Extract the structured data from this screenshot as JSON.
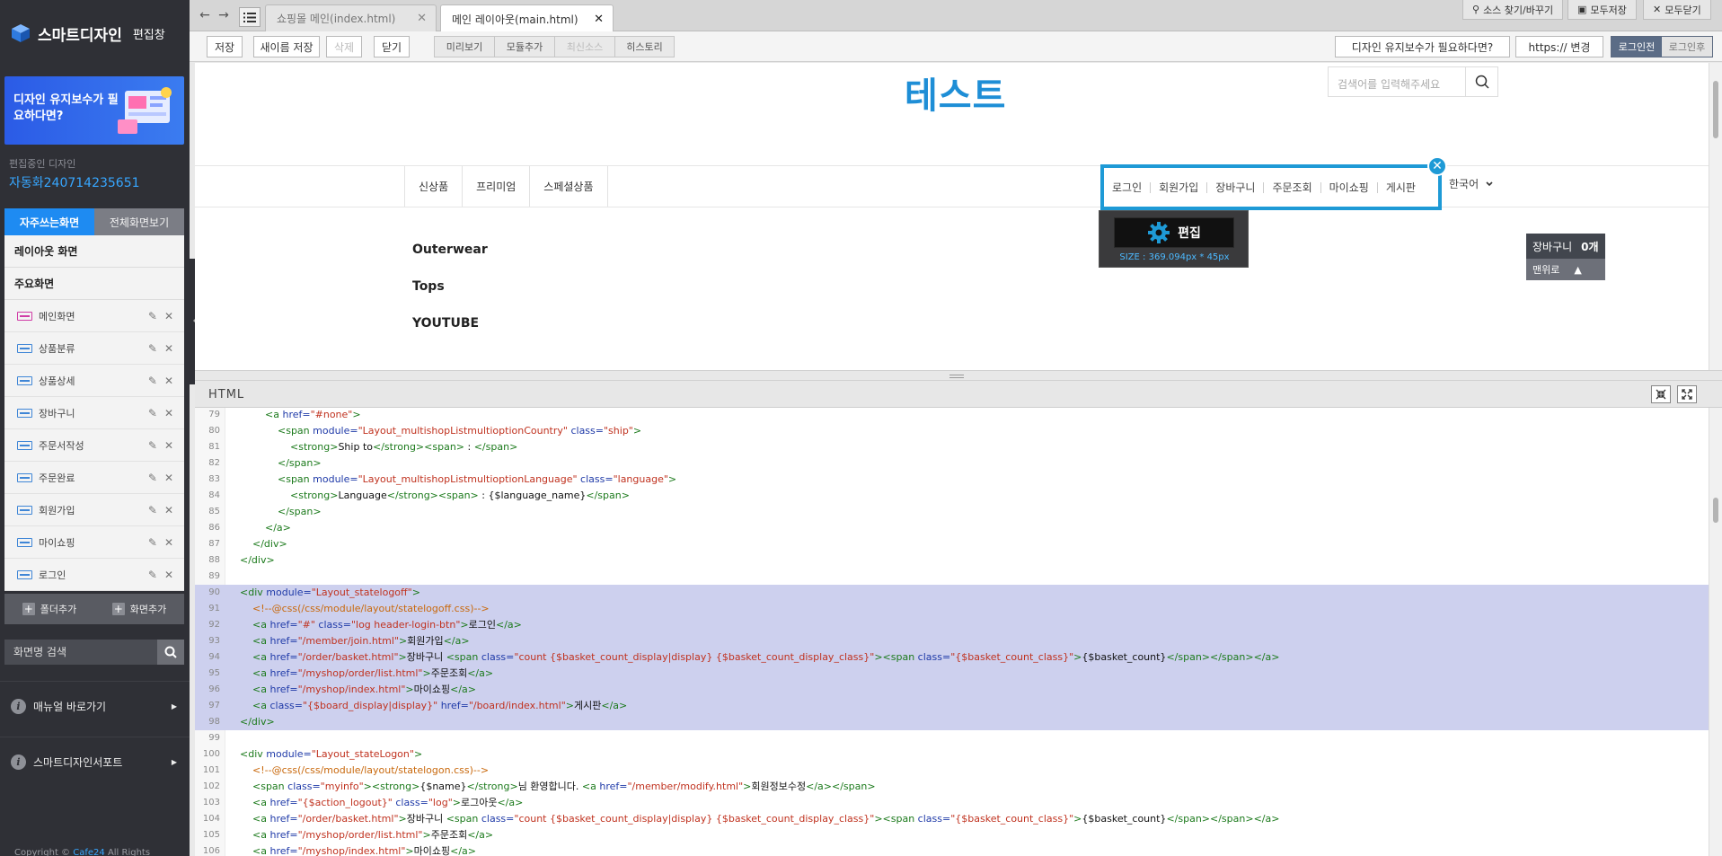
{
  "sidebar": {
    "brand": "스마트디자인",
    "brand_sub": "편집창",
    "banner_text": "디자인 유지보수가 필요하다면?",
    "editing_label": "편집중인 디자인",
    "editing_name": "자동화240714235651",
    "tab_frequent": "자주쓰는화면",
    "tab_all": "전체화면보기",
    "sections": [
      "레이아웃 화면",
      "주요화면"
    ],
    "pages": [
      "메인화면",
      "상품분류",
      "상품상세",
      "장바구니",
      "주문서작성",
      "주문완료",
      "회원가입",
      "마이쇼핑",
      "로그인"
    ],
    "add_folder": "폴더추가",
    "add_screen": "화면추가",
    "search_placeholder": "화면명 검색",
    "manual_link": "매뉴얼 바로가기",
    "support_link": "스마트디자인서포트",
    "copyright_prefix": "Copyright ©",
    "copyright_brand": "Cafe24",
    "copyright_suffix": "All Rights"
  },
  "topbar": {
    "tabs": [
      {
        "label": "쇼핑몰 메인(index.html)",
        "active": false
      },
      {
        "label": "메인 레이아웃(main.html)",
        "active": true
      }
    ],
    "find_replace": "소스 찾기/바꾸기",
    "save_all": "모두저장",
    "close_all": "모두닫기"
  },
  "toolbar": {
    "save": "저장",
    "save_as": "새이름 저장",
    "delete": "삭제",
    "close": "닫기",
    "preview": "미리보기",
    "add_module": "모듈추가",
    "latest_source": "최신소스",
    "history": "히스토리",
    "maintenance": "디자인 유지보수가 필요하다면?",
    "https_change": "https:// 변경",
    "before_login": "로그인전",
    "after_login": "로그인후"
  },
  "preview": {
    "logo": "테스트",
    "search_placeholder": "검색어를 입력해주세요",
    "categories": [
      "신상품",
      "프리미엄",
      "스페셜상품"
    ],
    "state_links": [
      "로그인",
      "회원가입",
      "장바구니",
      "주문조회",
      "마이쇼핑",
      "게시판"
    ],
    "language": "한국어",
    "edit_button": "편집",
    "size_text": "SIZE : 369.094px * 45px",
    "side_categories": [
      "Outerwear",
      "Tops",
      "YOUTUBE"
    ],
    "cart_label": "장바구니",
    "cart_count": "0개",
    "to_top": "맨위로"
  },
  "editor": {
    "label": "HTML",
    "lines": [
      {
        "n": "79",
        "sel": false,
        "ind": 4,
        "segs": [
          [
            "t",
            "<a "
          ],
          [
            "a",
            "href="
          ],
          [
            "v",
            "\"#none\""
          ],
          [
            "t",
            ">"
          ]
        ]
      },
      {
        "n": "80",
        "sel": false,
        "ind": 6,
        "segs": [
          [
            "t",
            "<span "
          ],
          [
            "a",
            "module="
          ],
          [
            "v",
            "\"Layout_multishopListmultioptionCountry\""
          ],
          [
            "a",
            " class="
          ],
          [
            "v",
            "\"ship\""
          ],
          [
            "t",
            ">"
          ]
        ]
      },
      {
        "n": "81",
        "sel": false,
        "ind": 8,
        "segs": [
          [
            "t",
            "<strong>"
          ],
          [
            "x",
            "Ship to"
          ],
          [
            "t",
            "</strong><span>"
          ],
          [
            "x",
            " : "
          ],
          [
            "t",
            "</span>"
          ]
        ]
      },
      {
        "n": "82",
        "sel": false,
        "ind": 6,
        "segs": [
          [
            "t",
            "</span>"
          ]
        ]
      },
      {
        "n": "83",
        "sel": false,
        "ind": 6,
        "segs": [
          [
            "t",
            "<span "
          ],
          [
            "a",
            "module="
          ],
          [
            "v",
            "\"Layout_multishopListmultioptionLanguage\""
          ],
          [
            "a",
            " class="
          ],
          [
            "v",
            "\"language\""
          ],
          [
            "t",
            ">"
          ]
        ]
      },
      {
        "n": "84",
        "sel": false,
        "ind": 8,
        "segs": [
          [
            "t",
            "<strong>"
          ],
          [
            "x",
            "Language"
          ],
          [
            "t",
            "</strong><span>"
          ],
          [
            "x",
            " : {$language_name}"
          ],
          [
            "t",
            "</span>"
          ]
        ]
      },
      {
        "n": "85",
        "sel": false,
        "ind": 6,
        "segs": [
          [
            "t",
            "</span>"
          ]
        ]
      },
      {
        "n": "86",
        "sel": false,
        "ind": 4,
        "segs": [
          [
            "t",
            "</a>"
          ]
        ]
      },
      {
        "n": "87",
        "sel": false,
        "ind": 2,
        "segs": [
          [
            "t",
            "</div>"
          ]
        ]
      },
      {
        "n": "88",
        "sel": false,
        "ind": 0,
        "segs": [
          [
            "t",
            "</div>"
          ]
        ]
      },
      {
        "n": "89",
        "sel": false,
        "ind": 0,
        "segs": []
      },
      {
        "n": "90",
        "sel": true,
        "ind": 0,
        "segs": [
          [
            "t",
            "<div "
          ],
          [
            "a",
            "module="
          ],
          [
            "v",
            "\"Layout_statelogoff\""
          ],
          [
            "t",
            ">"
          ]
        ]
      },
      {
        "n": "91",
        "sel": true,
        "ind": 2,
        "segs": [
          [
            "c",
            "<!--@css(/css/module/layout/statelogoff.css)-->"
          ]
        ]
      },
      {
        "n": "92",
        "sel": true,
        "ind": 2,
        "segs": [
          [
            "t",
            "<a "
          ],
          [
            "a",
            "href="
          ],
          [
            "v",
            "\"#\""
          ],
          [
            "a",
            " class="
          ],
          [
            "v",
            "\"log header-login-btn\""
          ],
          [
            "t",
            ">"
          ],
          [
            "x",
            "로그인"
          ],
          [
            "t",
            "</a>"
          ]
        ]
      },
      {
        "n": "93",
        "sel": true,
        "ind": 2,
        "segs": [
          [
            "t",
            "<a "
          ],
          [
            "a",
            "href="
          ],
          [
            "v",
            "\"/member/join.html\""
          ],
          [
            "t",
            ">"
          ],
          [
            "x",
            "회원가입"
          ],
          [
            "t",
            "</a>"
          ]
        ]
      },
      {
        "n": "94",
        "sel": true,
        "ind": 2,
        "segs": [
          [
            "t",
            "<a "
          ],
          [
            "a",
            "href="
          ],
          [
            "v",
            "\"/order/basket.html\""
          ],
          [
            "t",
            ">"
          ],
          [
            "x",
            "장바구니 "
          ],
          [
            "t",
            "<span "
          ],
          [
            "a",
            "class="
          ],
          [
            "v",
            "\"count {$basket_count_display|display} {$basket_count_display_class}\""
          ],
          [
            "t",
            "><span "
          ],
          [
            "a",
            "class="
          ],
          [
            "v",
            "\"{$basket_count_class}\""
          ],
          [
            "t",
            ">"
          ],
          [
            "x",
            "{$basket_count}"
          ],
          [
            "t",
            "</span></span></a>"
          ]
        ]
      },
      {
        "n": "95",
        "sel": true,
        "ind": 2,
        "segs": [
          [
            "t",
            "<a "
          ],
          [
            "a",
            "href="
          ],
          [
            "v",
            "\"/myshop/order/list.html\""
          ],
          [
            "t",
            ">"
          ],
          [
            "x",
            "주문조회"
          ],
          [
            "t",
            "</a>"
          ]
        ]
      },
      {
        "n": "96",
        "sel": true,
        "ind": 2,
        "segs": [
          [
            "t",
            "<a "
          ],
          [
            "a",
            "href="
          ],
          [
            "v",
            "\"/myshop/index.html\""
          ],
          [
            "t",
            ">"
          ],
          [
            "x",
            "마이쇼핑"
          ],
          [
            "t",
            "</a>"
          ]
        ]
      },
      {
        "n": "97",
        "sel": true,
        "ind": 2,
        "segs": [
          [
            "t",
            "<a "
          ],
          [
            "a",
            "class="
          ],
          [
            "v",
            "\"{$board_display|display}\""
          ],
          [
            "a",
            " href="
          ],
          [
            "v",
            "\"/board/index.html\""
          ],
          [
            "t",
            ">"
          ],
          [
            "x",
            "게시판"
          ],
          [
            "t",
            "</a>"
          ]
        ]
      },
      {
        "n": "98",
        "sel": true,
        "ind": 0,
        "segs": [
          [
            "t",
            "</div>"
          ]
        ]
      },
      {
        "n": "99",
        "sel": false,
        "ind": 0,
        "segs": []
      },
      {
        "n": "100",
        "sel": false,
        "ind": 0,
        "segs": [
          [
            "t",
            "<div "
          ],
          [
            "a",
            "module="
          ],
          [
            "v",
            "\"Layout_stateLogon\""
          ],
          [
            "t",
            ">"
          ]
        ]
      },
      {
        "n": "101",
        "sel": false,
        "ind": 2,
        "segs": [
          [
            "c",
            "<!--@css(/css/module/layout/statelogon.css)-->"
          ]
        ]
      },
      {
        "n": "102",
        "sel": false,
        "ind": 2,
        "segs": [
          [
            "t",
            "<span "
          ],
          [
            "a",
            "class="
          ],
          [
            "v",
            "\"myinfo\""
          ],
          [
            "t",
            "><strong>"
          ],
          [
            "x",
            "{$name}"
          ],
          [
            "t",
            "</strong>"
          ],
          [
            "x",
            "님 환영합니다. "
          ],
          [
            "t",
            "<a "
          ],
          [
            "a",
            "href="
          ],
          [
            "v",
            "\"/member/modify.html\""
          ],
          [
            "t",
            ">"
          ],
          [
            "x",
            "회원정보수정"
          ],
          [
            "t",
            "</a></span>"
          ]
        ]
      },
      {
        "n": "103",
        "sel": false,
        "ind": 2,
        "segs": [
          [
            "t",
            "<a "
          ],
          [
            "a",
            "href="
          ],
          [
            "v",
            "\"{$action_logout}\""
          ],
          [
            "a",
            " class="
          ],
          [
            "v",
            "\"log\""
          ],
          [
            "t",
            ">"
          ],
          [
            "x",
            "로그아웃"
          ],
          [
            "t",
            "</a>"
          ]
        ]
      },
      {
        "n": "104",
        "sel": false,
        "ind": 2,
        "segs": [
          [
            "t",
            "<a "
          ],
          [
            "a",
            "href="
          ],
          [
            "v",
            "\"/order/basket.html\""
          ],
          [
            "t",
            ">"
          ],
          [
            "x",
            "장바구니 "
          ],
          [
            "t",
            "<span "
          ],
          [
            "a",
            "class="
          ],
          [
            "v",
            "\"count {$basket_count_display|display} {$basket_count_display_class}\""
          ],
          [
            "t",
            "><span "
          ],
          [
            "a",
            "class="
          ],
          [
            "v",
            "\"{$basket_count_class}\""
          ],
          [
            "t",
            ">"
          ],
          [
            "x",
            "{$basket_count}"
          ],
          [
            "t",
            "</span></span></a>"
          ]
        ]
      },
      {
        "n": "105",
        "sel": false,
        "ind": 2,
        "segs": [
          [
            "t",
            "<a "
          ],
          [
            "a",
            "href="
          ],
          [
            "v",
            "\"/myshop/order/list.html\""
          ],
          [
            "t",
            ">"
          ],
          [
            "x",
            "주문조회"
          ],
          [
            "t",
            "</a>"
          ]
        ]
      },
      {
        "n": "106",
        "sel": false,
        "ind": 2,
        "segs": [
          [
            "t",
            "<a "
          ],
          [
            "a",
            "href="
          ],
          [
            "v",
            "\"/myshop/index.html\""
          ],
          [
            "t",
            ">"
          ],
          [
            "x",
            "마이쇼핑"
          ],
          [
            "t",
            "</a>"
          ]
        ]
      }
    ]
  }
}
